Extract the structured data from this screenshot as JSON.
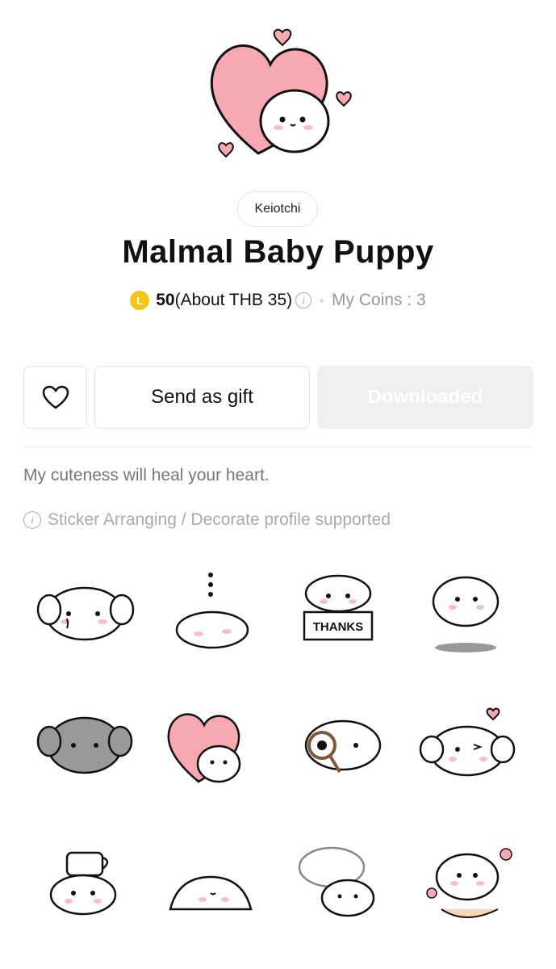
{
  "author": "Keiotchi",
  "title": "Malmal Baby Puppy",
  "price": {
    "coin_letter": "L",
    "amount": "50",
    "approx": "(About THB 35)",
    "info_glyph": "i",
    "separator": "•",
    "my_coins": "My Coins : 3"
  },
  "actions": {
    "favorite_icon": "heart-outline-icon",
    "gift_label": "Send as gift",
    "download_label": "Downloaded"
  },
  "description": "My cuteness will heal your heart.",
  "support_note": "Sticker Arranging / Decorate profile supported",
  "stickers": [
    {
      "name": "sticker-crying-puppy",
      "caption": ""
    },
    {
      "name": "sticker-sleeping-puppy",
      "caption": ""
    },
    {
      "name": "sticker-thanks-puppy",
      "caption": "THANKS"
    },
    {
      "name": "sticker-floating-puppy",
      "caption": ""
    },
    {
      "name": "sticker-gloomy-puppy",
      "caption": ""
    },
    {
      "name": "sticker-heart-puppy",
      "caption": ""
    },
    {
      "name": "sticker-magnifier-puppy",
      "caption": ""
    },
    {
      "name": "sticker-wink-puppy",
      "caption": ""
    },
    {
      "name": "sticker-coffee-puppy",
      "caption": ""
    },
    {
      "name": "sticker-lying-puppy",
      "caption": ""
    },
    {
      "name": "sticker-ghost-puppy",
      "caption": ""
    },
    {
      "name": "sticker-flower-puppy",
      "caption": ""
    }
  ],
  "colors": {
    "coin": "#f5c518",
    "heart_pink": "#f7a8b0",
    "download_bg": "#efefef"
  }
}
